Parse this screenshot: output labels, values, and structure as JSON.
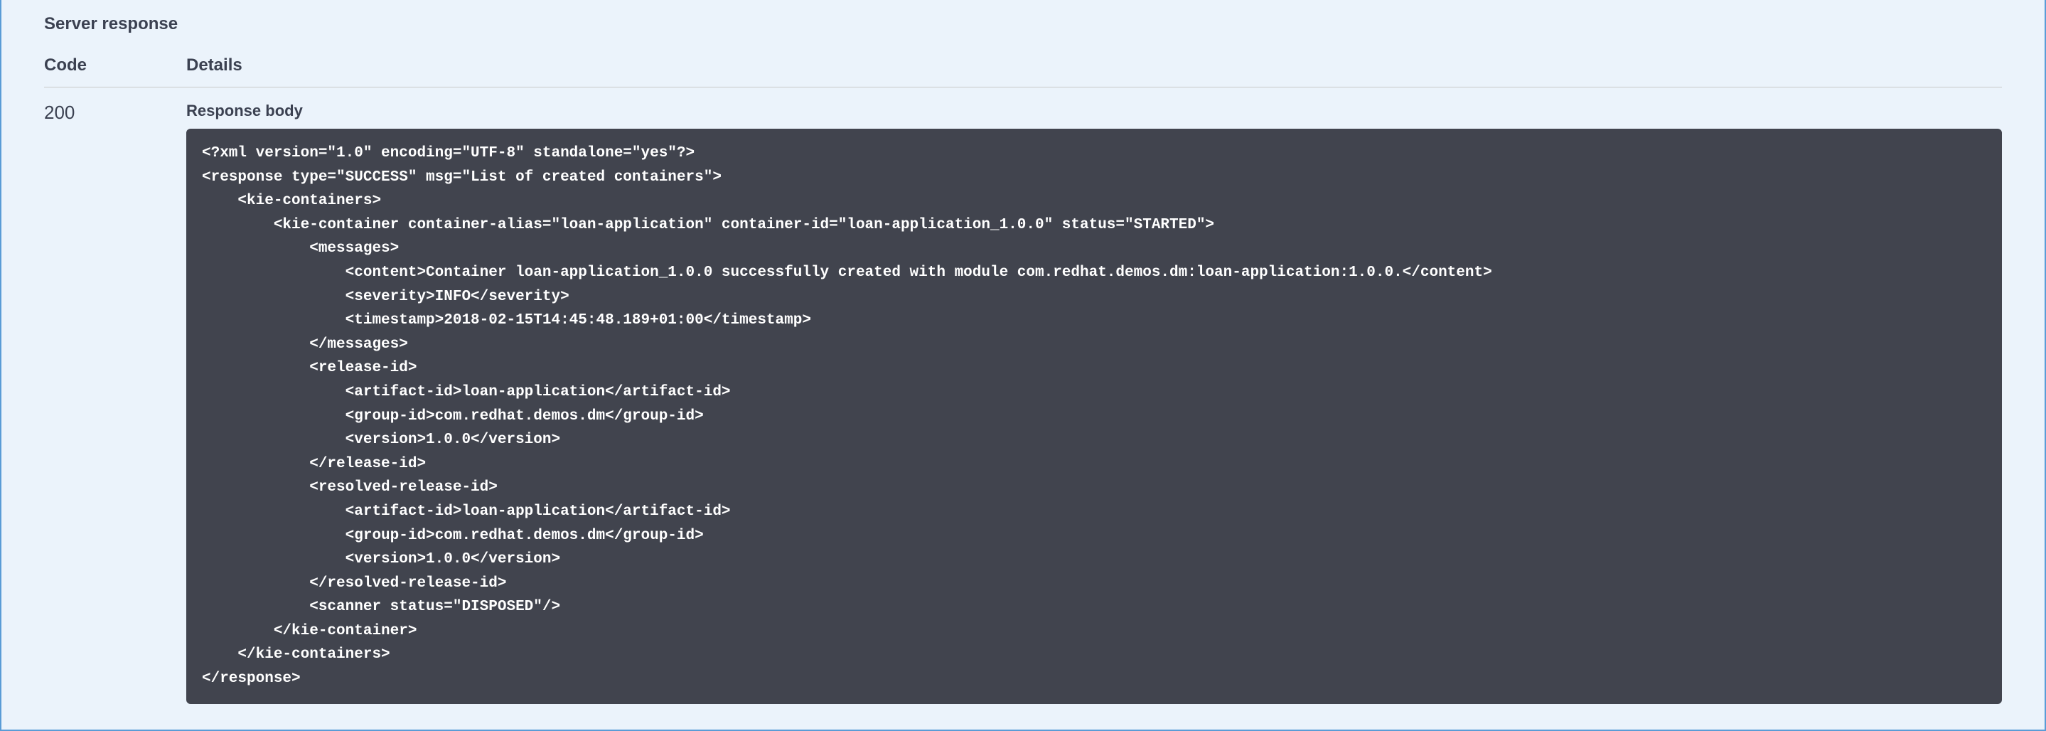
{
  "section_title": "Server response",
  "columns": {
    "code": "Code",
    "details": "Details"
  },
  "response": {
    "status_code": "200",
    "body_label": "Response body",
    "body_content": "<?xml version=\"1.0\" encoding=\"UTF-8\" standalone=\"yes\"?>\n<response type=\"SUCCESS\" msg=\"List of created containers\">\n    <kie-containers>\n        <kie-container container-alias=\"loan-application\" container-id=\"loan-application_1.0.0\" status=\"STARTED\">\n            <messages>\n                <content>Container loan-application_1.0.0 successfully created with module com.redhat.demos.dm:loan-application:1.0.0.</content>\n                <severity>INFO</severity>\n                <timestamp>2018-02-15T14:45:48.189+01:00</timestamp>\n            </messages>\n            <release-id>\n                <artifact-id>loan-application</artifact-id>\n                <group-id>com.redhat.demos.dm</group-id>\n                <version>1.0.0</version>\n            </release-id>\n            <resolved-release-id>\n                <artifact-id>loan-application</artifact-id>\n                <group-id>com.redhat.demos.dm</group-id>\n                <version>1.0.0</version>\n            </resolved-release-id>\n            <scanner status=\"DISPOSED\"/>\n        </kie-container>\n    </kie-containers>\n</response>"
  }
}
